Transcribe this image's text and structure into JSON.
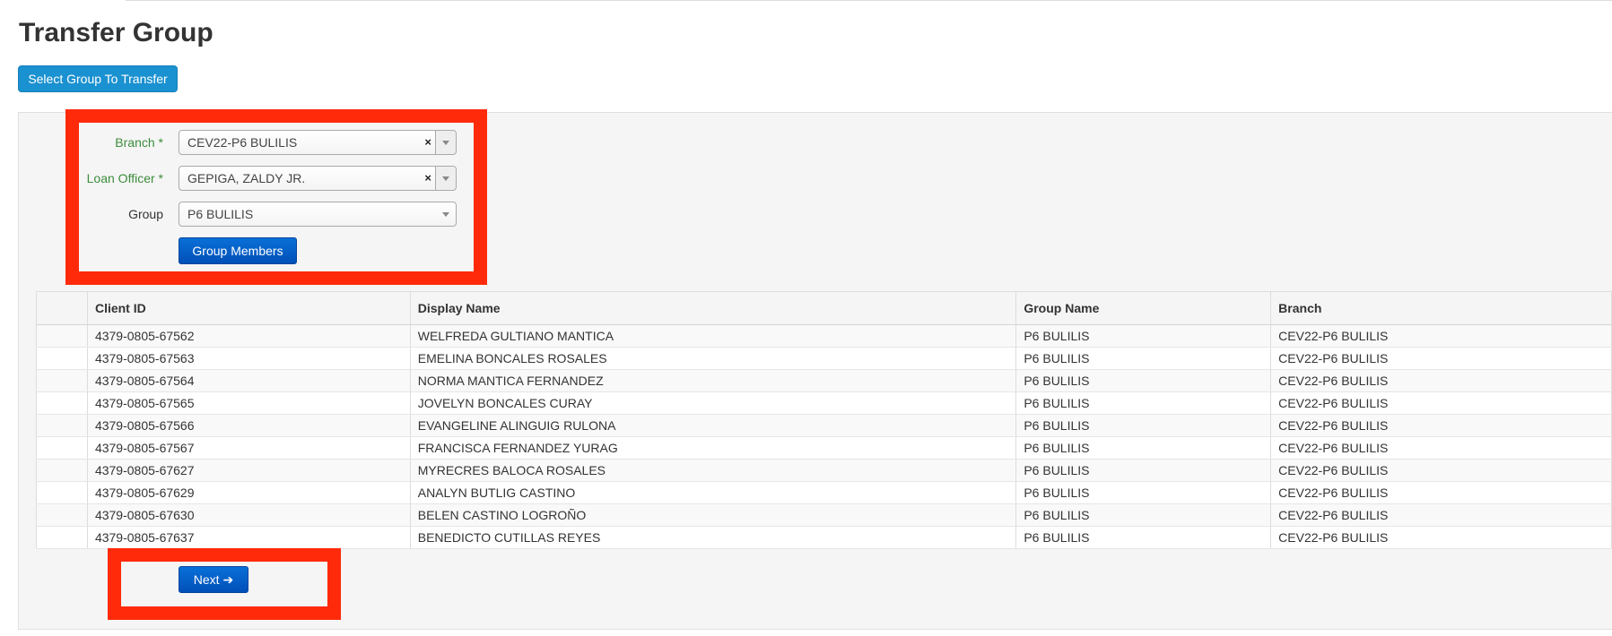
{
  "page": {
    "title": "Transfer Group"
  },
  "toolbar": {
    "select_group_label": "Select Group To Transfer"
  },
  "form": {
    "branch": {
      "label": "Branch *",
      "value": "CEV22-P6 BULILIS"
    },
    "loan_officer": {
      "label": "Loan Officer *",
      "value": "GEPIGA, ZALDY JR."
    },
    "group": {
      "label": "Group",
      "value": "P6 BULILIS"
    },
    "clear_symbol": "×",
    "group_members_label": "Group Members"
  },
  "table": {
    "columns": [
      "",
      "Client ID",
      "Display Name",
      "Group Name",
      "Branch"
    ],
    "rows": [
      [
        "",
        "4379-0805-67562",
        "WELFREDA GULTIANO MANTICA",
        "P6 BULILIS",
        "CEV22-P6 BULILIS"
      ],
      [
        "",
        "4379-0805-67563",
        "EMELINA BONCALES ROSALES",
        "P6 BULILIS",
        "CEV22-P6 BULILIS"
      ],
      [
        "",
        "4379-0805-67564",
        "NORMA MANTICA FERNANDEZ",
        "P6 BULILIS",
        "CEV22-P6 BULILIS"
      ],
      [
        "",
        "4379-0805-67565",
        "JOVELYN BONCALES CURAY",
        "P6 BULILIS",
        "CEV22-P6 BULILIS"
      ],
      [
        "",
        "4379-0805-67566",
        "EVANGELINE ALINGUIG RULONA",
        "P6 BULILIS",
        "CEV22-P6 BULILIS"
      ],
      [
        "",
        "4379-0805-67567",
        "FRANCISCA FERNANDEZ YURAG",
        "P6 BULILIS",
        "CEV22-P6 BULILIS"
      ],
      [
        "",
        "4379-0805-67627",
        "MYRECRES BALOCA ROSALES",
        "P6 BULILIS",
        "CEV22-P6 BULILIS"
      ],
      [
        "",
        "4379-0805-67629",
        "ANALYN BUTLIG CASTINO",
        "P6 BULILIS",
        "CEV22-P6 BULILIS"
      ],
      [
        "",
        "4379-0805-67630",
        "BELEN CASTINO LOGROÑO",
        "P6 BULILIS",
        "CEV22-P6 BULILIS"
      ],
      [
        "",
        "4379-0805-67637",
        "BENEDICTO CUTILLAS REYES",
        "P6 BULILIS",
        "CEV22-P6 BULILIS"
      ]
    ]
  },
  "footer": {
    "next_label": "Next",
    "next_arrow": "➔"
  },
  "colors": {
    "primary": "#0a6fd8",
    "select_button": "#1a91d0",
    "required_label": "#3c8d3c",
    "annotation_red": "#ff2a0a"
  }
}
